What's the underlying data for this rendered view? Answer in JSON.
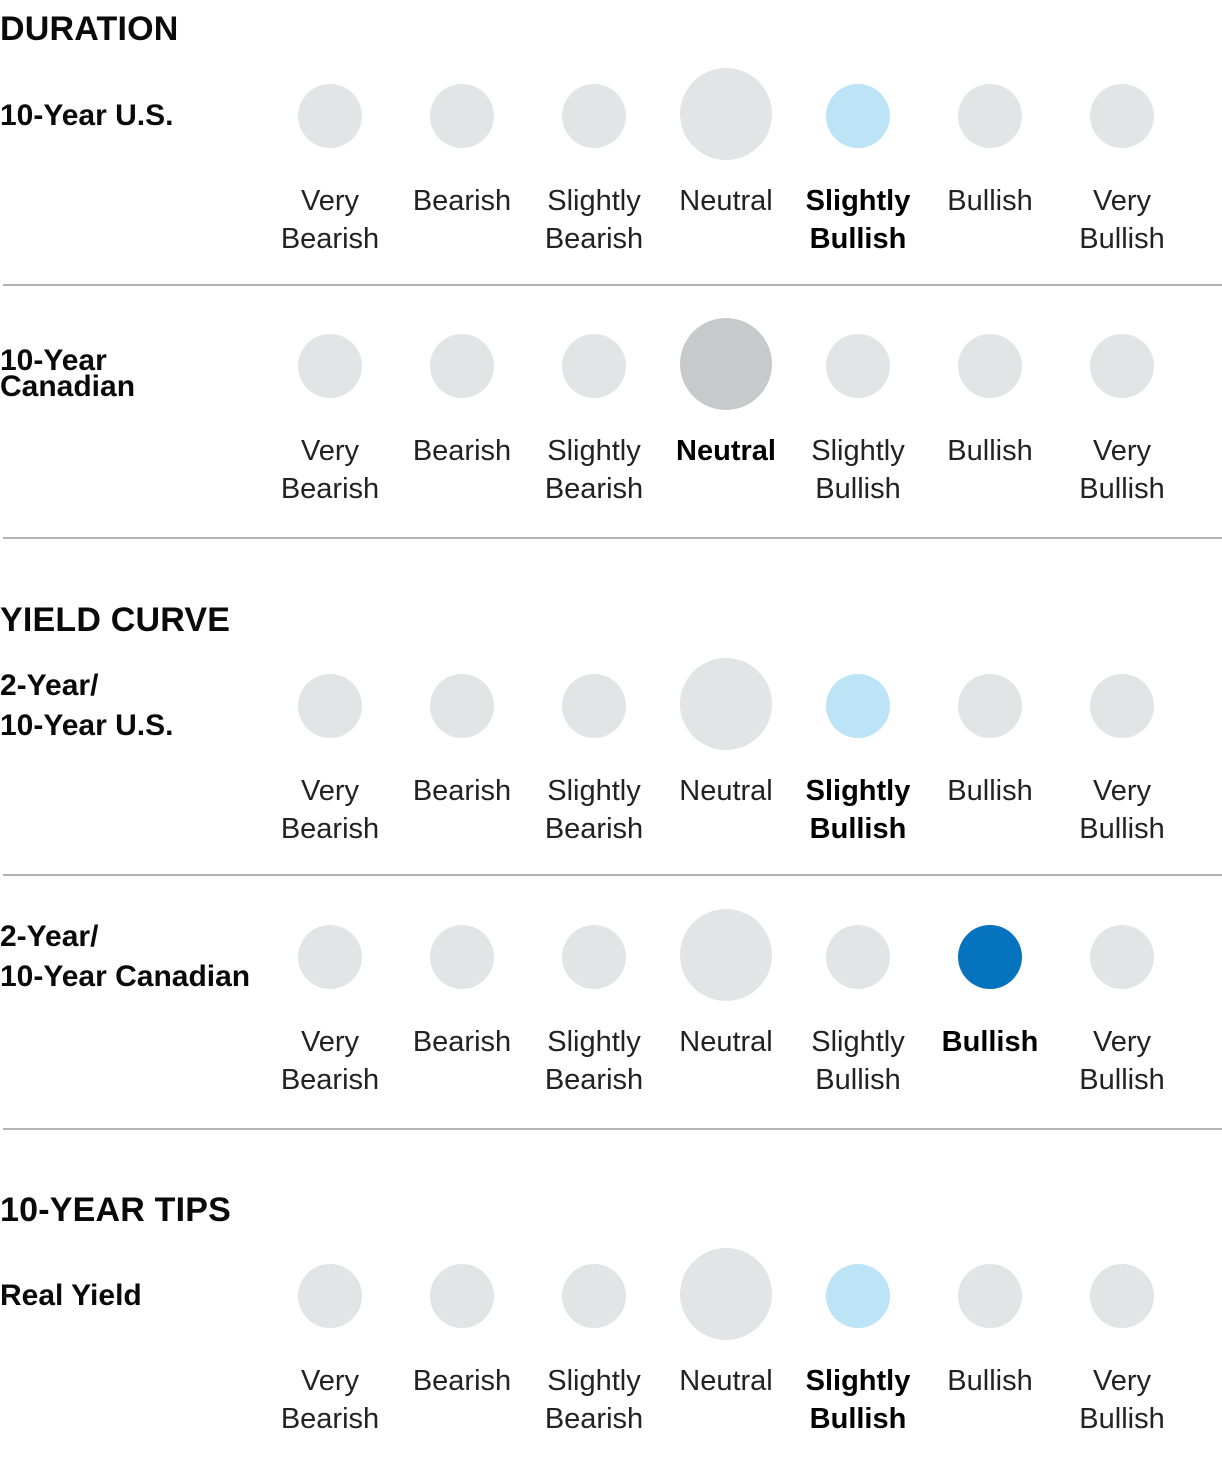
{
  "scale": [
    "Very\nBearish",
    "Bearish",
    "Slightly\nBearish",
    "Neutral",
    "Slightly\nBullish",
    "Bullish",
    "Very\nBullish"
  ],
  "colors": {
    "inactive": "#e2e4e5",
    "neutral_selected": "#c8c9cb",
    "slightly_selected": "#bde3f7",
    "strong_selected": "#0573bd"
  },
  "sections": [
    {
      "title": "DURATION",
      "rows": [
        {
          "label": "10-Year U.S.",
          "selected_index": 4,
          "selected_color": "#bde3f7"
        },
        {
          "label": "10-Year\nCanadian",
          "selected_index": 3,
          "selected_color": "#c8c9cb"
        }
      ]
    },
    {
      "title": "YIELD CURVE",
      "rows": [
        {
          "label": "2-Year/\n10-Year U.S.",
          "selected_index": 4,
          "selected_color": "#bde3f7"
        },
        {
          "label": "2-Year/\n10-Year Canadian",
          "selected_index": 5,
          "selected_color": "#0573bd"
        }
      ]
    },
    {
      "title": "10-YEAR TIPS",
      "rows": [
        {
          "label": "Real Yield",
          "selected_index": 4,
          "selected_color": "#bde3f7"
        }
      ]
    }
  ]
}
